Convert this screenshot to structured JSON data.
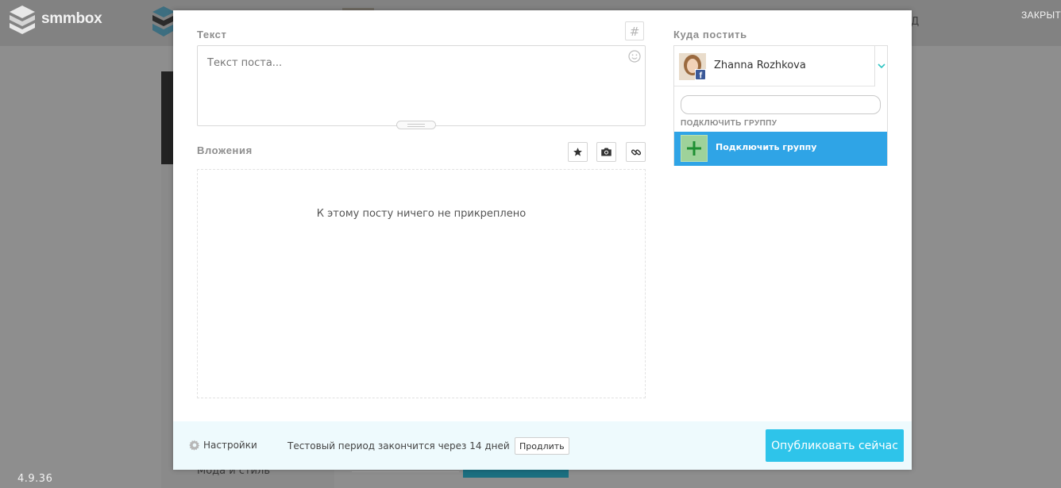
{
  "app": {
    "logo_text": "smmbox",
    "close_label": "ЗАКРЫТ",
    "header_fragment": "Д",
    "sidebar_item_partial": "Мода и стиль",
    "version": "4.9.36"
  },
  "composer": {
    "text_label": "Текст",
    "hashtag_symbol": "#",
    "text_placeholder": "Текст поста...",
    "text_value": "",
    "attachments_label": "Вложения",
    "attachment_buttons": [
      "star-icon",
      "camera-icon",
      "link-icon"
    ],
    "empty_attachments": "К этому посту ничего не прикреплено"
  },
  "targets": {
    "label": "Куда постить",
    "selected_account": "Zhanna Rozhkova",
    "search_value": "",
    "group_header": "ПОДКЛЮЧИТЬ ГРУППУ",
    "connect_group_label": "Подключить группу"
  },
  "footer": {
    "settings_label": "Настройки",
    "trial_text": "Тестовый период закончится через 14 дней",
    "extend_label": "Продлить",
    "publish_label": "Опубликовать сейчас"
  },
  "colors": {
    "accent": "#2ec4ea",
    "connect_row": "#2fa4e6",
    "footer_bg": "#eefafd",
    "overlay": "#8e8e8e"
  }
}
